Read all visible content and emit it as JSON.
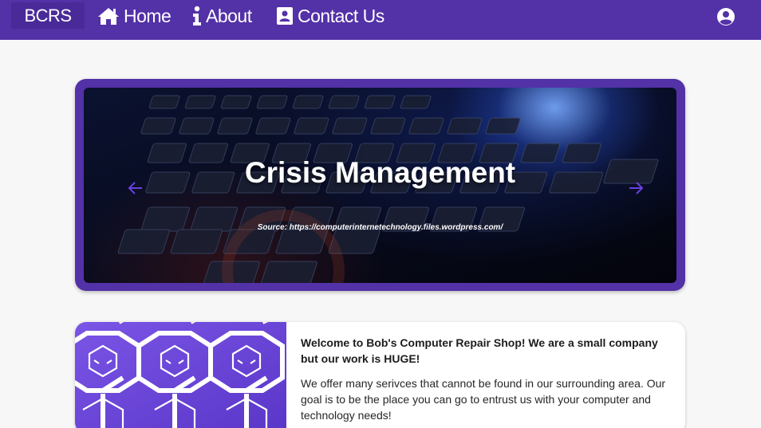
{
  "nav": {
    "brand": "BCRS",
    "items": [
      {
        "label": "Home",
        "icon": "home-icon"
      },
      {
        "label": "About",
        "icon": "info-icon"
      },
      {
        "label": "Contact Us",
        "icon": "contact-card-icon"
      }
    ],
    "account_icon": "account-circle-icon"
  },
  "carousel": {
    "title": "Crisis Management",
    "source": "Source: https://computerinternetechnology.files.wordpress.com/",
    "prev_icon": "arrow-left-icon",
    "next_icon": "arrow-right-icon"
  },
  "welcome": {
    "heading": "Welcome to Bob's Computer Repair Shop! We are a small company but our work is HUGE!",
    "body": "We offer many serivces that cannot be found in our surrounding area. Our goal is to be the place you can go to entrust us with your computer and technology needs!"
  },
  "colors": {
    "primary": "#5331a7",
    "brand_bg": "#4a2a98",
    "background": "#f7f7f7",
    "arrow": "#6a40e0"
  }
}
